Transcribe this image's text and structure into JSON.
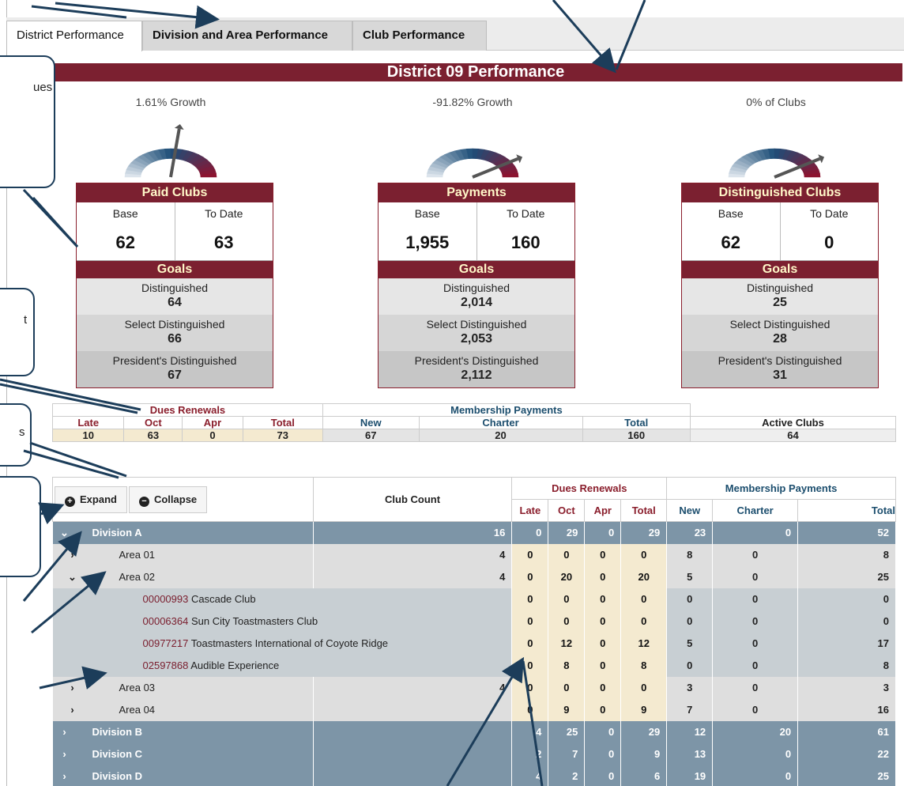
{
  "tabs": [
    "District Performance",
    "Division and Area Performance",
    "Club Performance"
  ],
  "banner": "District 09 Performance",
  "callouts": [
    {
      "text": "ues"
    },
    {
      "text": "t"
    },
    {
      "text": "s"
    }
  ],
  "metrics": [
    {
      "growth": "1.61% Growth",
      "title": "Paid Clubs",
      "base_label": "Base",
      "todate_label": "To Date",
      "base": "62",
      "todate": "63",
      "goals_label": "Goals",
      "goals": [
        {
          "label": "Distinguished",
          "value": "64"
        },
        {
          "label": "Select Distinguished",
          "value": "66"
        },
        {
          "label": "President's Distinguished",
          "value": "67"
        }
      ],
      "needle_angle": -10
    },
    {
      "growth": "-91.82% Growth",
      "title": "Payments",
      "base_label": "Base",
      "todate_label": "To Date",
      "base": "1,955",
      "todate": "160",
      "goals_label": "Goals",
      "goals": [
        {
          "label": "Distinguished",
          "value": "2,014"
        },
        {
          "label": "Select Distinguished",
          "value": "2,053"
        },
        {
          "label": "President's Distinguished",
          "value": "2,112"
        }
      ],
      "needle_angle": -68
    },
    {
      "growth": "0% of Clubs",
      "title": "Distinguished Clubs",
      "base_label": "Base",
      "todate_label": "To Date",
      "base": "62",
      "todate": "0",
      "goals_label": "Goals",
      "goals": [
        {
          "label": "Distinguished",
          "value": "25"
        },
        {
          "label": "Select Distinguished",
          "value": "28"
        },
        {
          "label": "President's Distinguished",
          "value": "31"
        }
      ],
      "needle_angle": -68
    }
  ],
  "summary": {
    "dues_label": "Dues Renewals",
    "membership_label": "Membership Payments",
    "cols": [
      "Late",
      "Oct",
      "Apr",
      "Total",
      "New",
      "Charter",
      "Total",
      "Active Clubs"
    ],
    "values": [
      "10",
      "63",
      "0",
      "73",
      "67",
      "20",
      "160",
      "64"
    ]
  },
  "division_table": {
    "expand_label": "Expand",
    "collapse_label": "Collapse",
    "club_count_label": "Club Count",
    "dues_label": "Dues Renewals",
    "membership_label": "Membership Payments",
    "cols": [
      "Late",
      "Oct",
      "Apr",
      "Total",
      "New",
      "Charter",
      "Total"
    ],
    "rows": [
      {
        "kind": "div",
        "chev": "v",
        "name": "Division A",
        "count": "16",
        "vals": [
          "0",
          "29",
          "0",
          "29",
          "23",
          "0",
          "52"
        ]
      },
      {
        "kind": "area",
        "chev": ">",
        "name": "Area 01",
        "count": "4",
        "vals": [
          "0",
          "0",
          "0",
          "0",
          "8",
          "0",
          "8"
        ]
      },
      {
        "kind": "area",
        "chev": "v",
        "name": "Area 02",
        "count": "4",
        "vals": [
          "0",
          "20",
          "0",
          "20",
          "5",
          "0",
          "25"
        ]
      },
      {
        "kind": "club",
        "id": "00000993",
        "name": "Cascade Club",
        "vals": [
          "0",
          "0",
          "0",
          "0",
          "0",
          "0",
          "0"
        ]
      },
      {
        "kind": "club",
        "id": "00006364",
        "name": "Sun City Toastmasters Club",
        "vals": [
          "0",
          "0",
          "0",
          "0",
          "0",
          "0",
          "0"
        ]
      },
      {
        "kind": "club",
        "id": "00977217",
        "name": "Toastmasters International of Coyote Ridge",
        "vals": [
          "0",
          "12",
          "0",
          "12",
          "5",
          "0",
          "17"
        ]
      },
      {
        "kind": "club",
        "id": "02597868",
        "name": "Audible Experience",
        "vals": [
          "0",
          "8",
          "0",
          "8",
          "0",
          "0",
          "8"
        ]
      },
      {
        "kind": "area",
        "chev": ">",
        "name": "Area 03",
        "count": "4",
        "vals": [
          "0",
          "0",
          "0",
          "0",
          "3",
          "0",
          "3"
        ]
      },
      {
        "kind": "area",
        "chev": ">",
        "name": "Area 04",
        "count": "",
        "vals": [
          "0",
          "9",
          "0",
          "9",
          "7",
          "0",
          "16"
        ]
      },
      {
        "kind": "div",
        "chev": ">",
        "name": "Division B",
        "count": "",
        "vals": [
          "4",
          "25",
          "0",
          "29",
          "12",
          "20",
          "61"
        ]
      },
      {
        "kind": "div",
        "chev": ">",
        "name": "Division C",
        "count": "",
        "vals": [
          "2",
          "7",
          "0",
          "9",
          "13",
          "0",
          "22"
        ]
      },
      {
        "kind": "div",
        "chev": ">",
        "name": "Division D",
        "count": "",
        "vals": [
          "4",
          "2",
          "0",
          "6",
          "19",
          "0",
          "25"
        ]
      }
    ]
  }
}
